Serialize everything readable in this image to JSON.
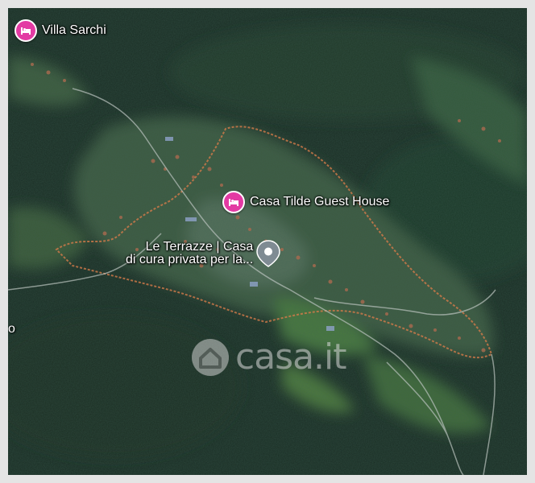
{
  "map": {
    "markers": [
      {
        "label": "Villa Sarchi",
        "icon": "hotel-bed-icon",
        "color": "#e33aa3"
      },
      {
        "label": "Casa Tilde Guest House",
        "icon": "hotel-bed-icon",
        "color": "#e33aa3"
      },
      {
        "label_line1": "Le Terrazze | Casa",
        "label_line2": "di cura privata per la...",
        "icon": "location-pin-icon",
        "color": "#7f8b93"
      }
    ],
    "edge_label": "o",
    "watermark": {
      "text": "casa.it",
      "icon": "house-logo-icon"
    }
  }
}
